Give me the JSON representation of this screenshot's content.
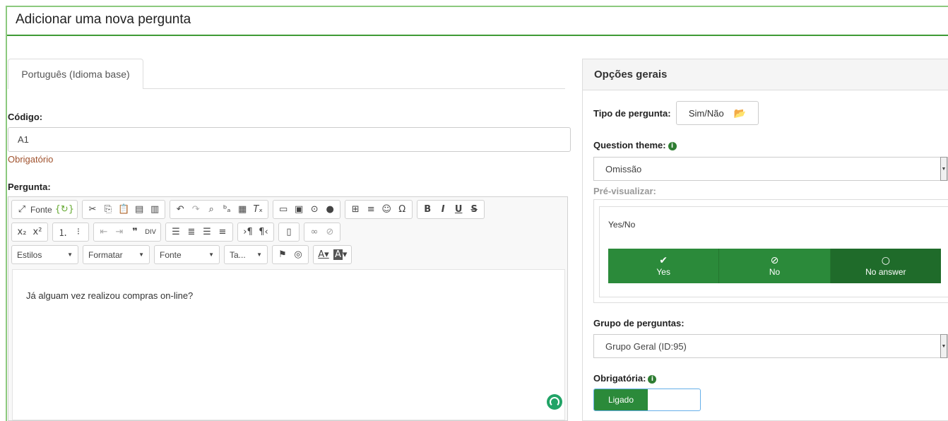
{
  "page": {
    "title": "Adicionar uma nova pergunta"
  },
  "language_tab": {
    "label": "Português (Idioma base)"
  },
  "code": {
    "label": "Código:",
    "value": "A1",
    "required_text": "Obrigatório"
  },
  "question": {
    "label": "Pergunta:",
    "text": "Já alguam vez realizou compras on-line?",
    "toolbar": {
      "row1": {
        "source_label": "Fonte",
        "icons": [
          "maximize-icon",
          "source-icon",
          "cut-icon",
          "copy-icon",
          "paste-icon",
          "paste-text-icon",
          "paste-word-icon",
          "undo-icon",
          "redo-icon",
          "find-icon",
          "replace-icon",
          "select-all-icon",
          "remove-format-icon",
          "image-icon",
          "video-icon",
          "play-icon",
          "flash-icon",
          "table-icon",
          "hr-icon",
          "smiley-icon",
          "special-char-icon",
          "bold-icon",
          "italic-icon",
          "underline-icon",
          "strike-icon"
        ]
      },
      "row2": {
        "icons": [
          "subscript-icon",
          "superscript-icon",
          "numbered-list-icon",
          "bulleted-list-icon",
          "outdent-icon",
          "indent-icon",
          "blockquote-icon",
          "div-icon",
          "align-left-icon",
          "align-center-icon",
          "align-right-icon",
          "justify-icon",
          "ltr-icon",
          "rtl-icon",
          "template-icon",
          "link-icon",
          "unlink-icon"
        ]
      },
      "row3": {
        "styles": "Estilos",
        "format": "Formatar",
        "font": "Fonte",
        "size": "Ta...",
        "icons": [
          "anchor-flag-icon",
          "language-globe-icon",
          "text-color-icon",
          "bg-color-icon"
        ]
      }
    }
  },
  "general_options": {
    "title": "Opções gerais",
    "question_type": {
      "label": "Tipo de pergunta:",
      "value": "Sim/Não"
    },
    "question_theme": {
      "label": "Question theme:",
      "value": "Omissão"
    },
    "preview": {
      "label": "Pré-visualizar:",
      "question": "Yes/No",
      "options": [
        {
          "icon": "✔",
          "label": "Yes"
        },
        {
          "icon": "⊘",
          "label": "No"
        },
        {
          "icon": "○",
          "label": "No answer"
        }
      ]
    },
    "question_group": {
      "label": "Grupo de perguntas:",
      "value": "Grupo Geral (ID:95)"
    },
    "mandatory": {
      "label": "Obrigatória:",
      "value": "Ligado"
    }
  }
}
